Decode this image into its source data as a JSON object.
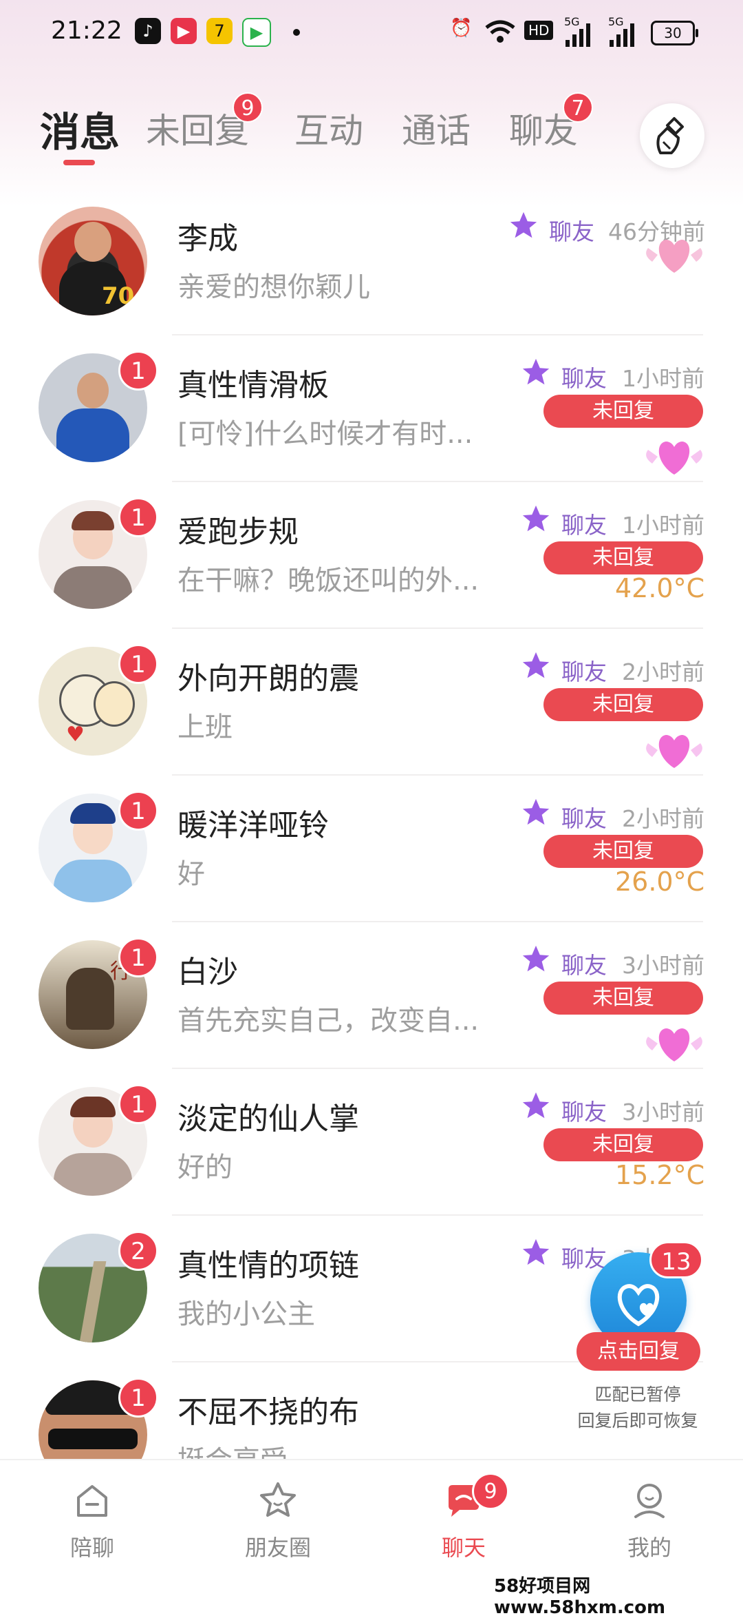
{
  "status_bar": {
    "time": "21:22",
    "net_label": "HD",
    "signal_1": "5G",
    "signal_2": "5G",
    "battery": "30"
  },
  "tabs": [
    {
      "label": "消息",
      "badge": ""
    },
    {
      "label": "未回复",
      "badge": "9"
    },
    {
      "label": "互动",
      "badge": ""
    },
    {
      "label": "通话",
      "badge": ""
    },
    {
      "label": "聊友",
      "badge": "7"
    }
  ],
  "conversations": [
    {
      "name": "李成",
      "preview": "亲爱的想你颖儿",
      "relation": "聊友",
      "time": "46分钟前",
      "unread": "",
      "status": "",
      "extra_type": "heart",
      "extra": ""
    },
    {
      "name": "真性情滑板",
      "preview": "[可怜]什么时候才有时...",
      "relation": "聊友",
      "time": "1小时前",
      "unread": "1",
      "status": "未回复",
      "extra_type": "heart",
      "extra": ""
    },
    {
      "name": "爱跑步规",
      "preview": "在干嘛？晚饭还叫的外...",
      "relation": "聊友",
      "time": "1小时前",
      "unread": "1",
      "status": "未回复",
      "extra_type": "temp",
      "extra": "42.0°C"
    },
    {
      "name": "外向开朗的震",
      "preview": "上班",
      "relation": "聊友",
      "time": "2小时前",
      "unread": "1",
      "status": "未回复",
      "extra_type": "heart",
      "extra": ""
    },
    {
      "name": "暖洋洋哑铃",
      "preview": "好",
      "relation": "聊友",
      "time": "2小时前",
      "unread": "1",
      "status": "未回复",
      "extra_type": "temp",
      "extra": "26.0°C"
    },
    {
      "name": "白沙",
      "preview": "首先充实自己，改变自...",
      "relation": "聊友",
      "time": "3小时前",
      "unread": "1",
      "status": "未回复",
      "extra_type": "heart",
      "extra": ""
    },
    {
      "name": "淡定的仙人掌",
      "preview": "好的",
      "relation": "聊友",
      "time": "3小时前",
      "unread": "1",
      "status": "未回复",
      "extra_type": "temp",
      "extra": "15.2°C"
    },
    {
      "name": "真性情的项链",
      "preview": "我的小公主",
      "relation": "聊友",
      "time": "3小",
      "unread": "2",
      "status": "",
      "extra_type": "",
      "extra": ""
    },
    {
      "name": "不屈不挠的布",
      "preview": "挺会享受",
      "relation": "",
      "time": "",
      "unread": "1",
      "status": "",
      "extra_type": "",
      "extra": ""
    }
  ],
  "float_widget": {
    "badge": "13",
    "button": "点击回复",
    "note_line1": "匹配已暂停",
    "note_line2": "回复后即可恢复"
  },
  "bottom_nav": [
    {
      "label": "陪聊",
      "badge": ""
    },
    {
      "label": "朋友圈",
      "badge": ""
    },
    {
      "label": "聊天",
      "badge": "9"
    },
    {
      "label": "我的",
      "badge": ""
    }
  ],
  "watermark": "58好项目网www.58hxm.com",
  "colors": {
    "accent": "#ea4a51",
    "badge": "#ec4150",
    "relation": "#8a63c8",
    "temp": "#e4a24d",
    "float": "#1e86d8"
  }
}
